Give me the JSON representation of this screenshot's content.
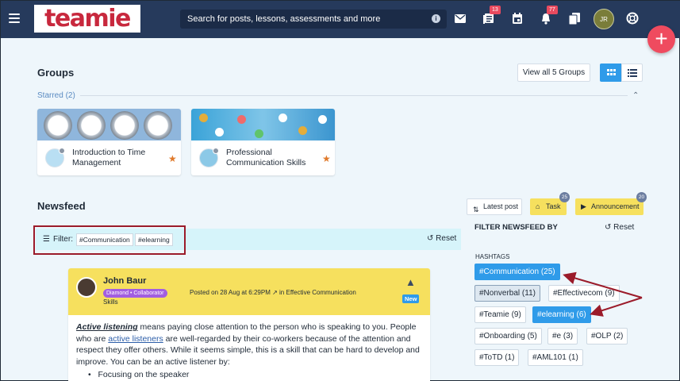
{
  "app": {
    "logo": "teamie",
    "search_placeholder": "Search for posts, lessons, assessments and more",
    "badges": {
      "lessons": "13",
      "notifications": "77"
    },
    "user_initials": "JR",
    "fab_label": "+"
  },
  "groups": {
    "title": "Groups",
    "view_all": "View all 5 Groups",
    "starred_label": "Starred (2)",
    "cards": [
      {
        "title": "Introduction to Time Management"
      },
      {
        "title": "Professional Communication Skills"
      }
    ]
  },
  "newsfeed": {
    "title": "Newsfeed",
    "latest_post": "Latest post",
    "task": {
      "label": "Task",
      "count": "25"
    },
    "announcement": {
      "label": "Announcement",
      "count": "20"
    },
    "filter_label": "Filter:",
    "chips": [
      "#Communication",
      "#elearning"
    ],
    "reset": "Reset"
  },
  "post": {
    "author": "John Baur",
    "badge": "Diamond • Collaborator",
    "posted": "Posted on 28 Aug at 6:29PM",
    "group_prefix": "in",
    "group": "Effective Communication",
    "group_cont": "Skills",
    "new_label": "New",
    "body_bold": "Active listening",
    "body_1": " means paying close attention to the person who is speaking to you. People who are ",
    "body_link": "active listeners",
    "body_2": " are well-regarded by their co-workers because of the attention and respect they offer others. While it seems simple, this is a skill that can be hard to develop and improve. You can be an active listener by:",
    "bullet_1": "Focusing on the speaker"
  },
  "sidebar": {
    "title": "FILTER NEWSFEED BY",
    "reset": "Reset",
    "hashtags_label": "HASHTAGS",
    "tags": [
      "#Communication (25)",
      "#Nonverbal (11)",
      "#Effectivecom (9)",
      "#Teamie (9)",
      "#elearning (6)",
      "#Onboarding (5)",
      "#e (3)",
      "#OLP (2)",
      "#ToTD (1)",
      "#AML101 (1)"
    ]
  },
  "colors": {
    "topbar": "#263a5c",
    "accent": "#2f9be9",
    "yellow": "#f6e05e",
    "fab": "#ef4b5f",
    "highlight_box": "#9b1b2a"
  }
}
